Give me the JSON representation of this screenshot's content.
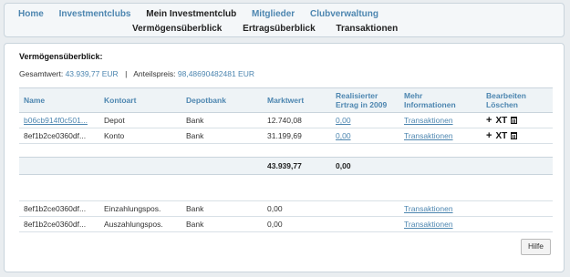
{
  "nav": {
    "primary": [
      "Home",
      "Investmentclubs",
      "Mein Investmentclub",
      "Mitglieder",
      "Clubverwaltung"
    ],
    "active_index": 2,
    "secondary": [
      "Vermögensüberblick",
      "Ertragsüberblick",
      "Transaktionen"
    ]
  },
  "overview": {
    "title": "Vermögensüberblick:",
    "total_label": "Gesamtwert:",
    "total_value": "43.939,77 EUR",
    "separator": "|",
    "share_label": "Anteilspreis:",
    "share_value": "98,48690482481 EUR"
  },
  "table": {
    "headers": {
      "name": "Name",
      "kontoart": "Kontoart",
      "depotbank": "Depotbank",
      "marktwert": "Marktwert",
      "ertrag_l1": "Realisierter",
      "ertrag_l2": "Ertrag in 2009",
      "info_l1": "Mehr",
      "info_l2": "Informationen",
      "edit_l1": "Bearbeiten",
      "edit_l2": "Löschen"
    },
    "rows": [
      {
        "name": "b06cb914f0c501...",
        "kontoart": "Depot",
        "depotbank": "Bank",
        "marktwert": "12.740,08",
        "ertrag": "0,00",
        "info": "Transaktionen"
      },
      {
        "name": "8ef1b2ce0360df...",
        "kontoart": "Konto",
        "depotbank": "Bank",
        "marktwert": "31.199,69",
        "ertrag": "0,00",
        "info": "Transaktionen"
      }
    ],
    "total": {
      "marktwert": "43.939,77",
      "ertrag": "0,00"
    },
    "extra_rows": [
      {
        "name": "8ef1b2ce0360df...",
        "kontoart": "Einzahlungspos.",
        "depotbank": "Bank",
        "marktwert": "0,00",
        "info": "Transaktionen"
      },
      {
        "name": "8ef1b2ce0360df...",
        "kontoart": "Auszahlungspos.",
        "depotbank": "Bank",
        "marktwert": "0,00",
        "info": "Transaktionen"
      }
    ],
    "action_icons": {
      "add": "+",
      "rename": "XT"
    }
  },
  "help_label": "Hilfe"
}
